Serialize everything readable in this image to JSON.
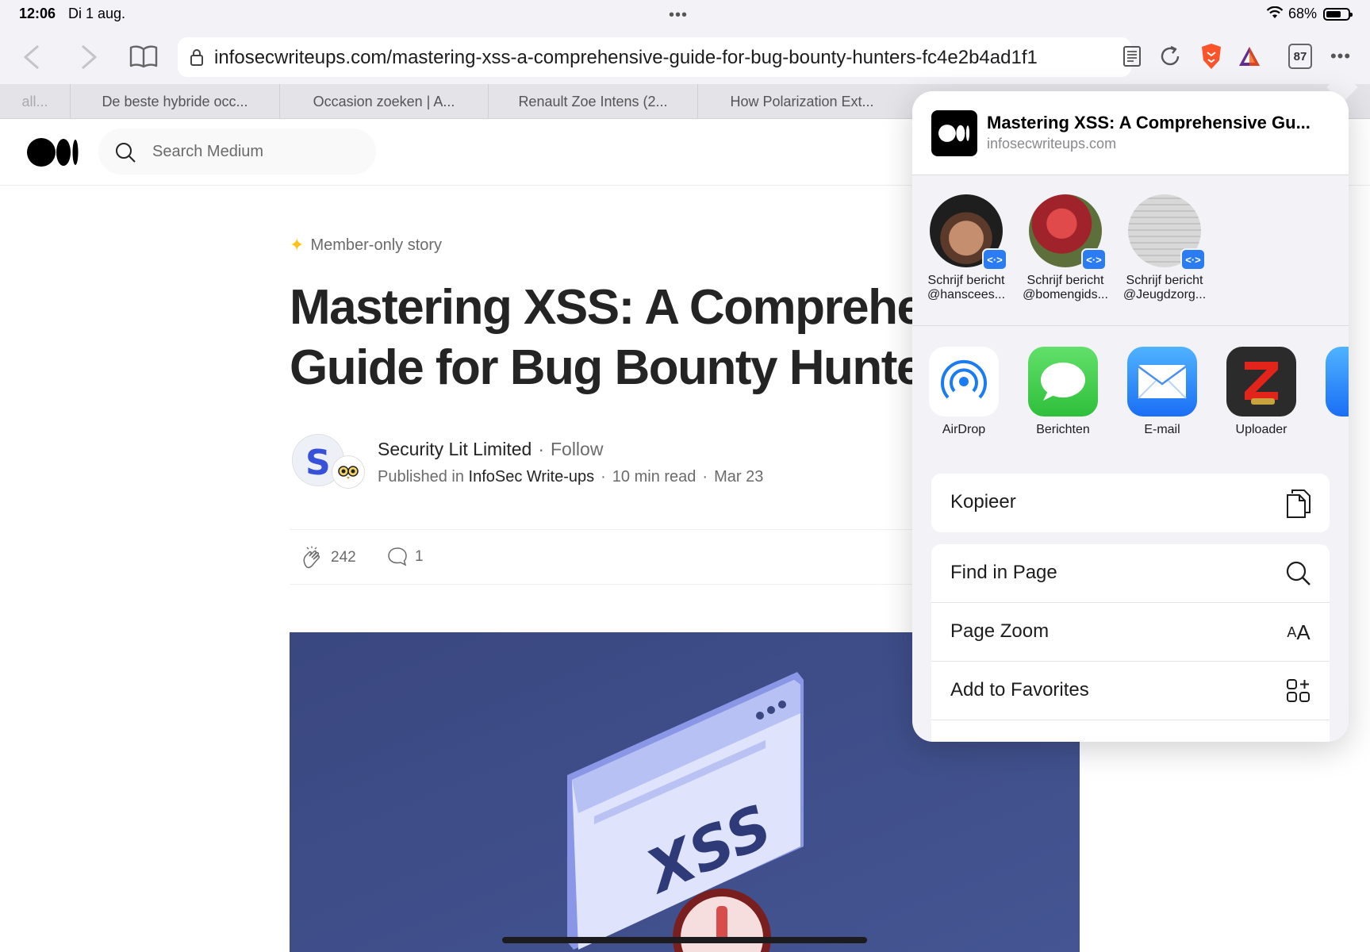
{
  "status_bar": {
    "time": "12:06",
    "date": "Di 1 aug.",
    "battery_percent": "68%",
    "battery_level": 0.68
  },
  "toolbar": {
    "url": "infosecwriteups.com/mastering-xss-a-comprehensive-guide-for-bug-bounty-hunters-fc4e2b4ad1f1",
    "tab_count": "87"
  },
  "tabs": [
    {
      "label": "all..."
    },
    {
      "label": "De beste hybride occ..."
    },
    {
      "label": "Occasion zoeken | A..."
    },
    {
      "label": "Renault Zoe Intens (2..."
    },
    {
      "label": "How Polarization Ext..."
    }
  ],
  "medium": {
    "search_placeholder": "Search Medium"
  },
  "article": {
    "member_label": "Member-only story",
    "title_line1": "Mastering XSS: A Comprehe",
    "title_line2": "Guide for Bug Bounty Hunter",
    "author": "Security Lit Limited",
    "follow_label": "Follow",
    "published_in_label": "Published in",
    "publication": "InfoSec Write-ups",
    "read_time": "10 min read",
    "date": "Mar 23",
    "claps": "242",
    "responses": "1",
    "hero_text": "XSS"
  },
  "share_sheet": {
    "title": "Mastering XSS: A Comprehensive Gu...",
    "domain": "infosecwriteups.com",
    "contacts": [
      {
        "line1": "Schrijf bericht",
        "line2": "@hanscees..."
      },
      {
        "line1": "Schrijf bericht",
        "line2": "@bomengids..."
      },
      {
        "line1": "Schrijf bericht",
        "line2": "@Jeugdzorg..."
      }
    ],
    "apps": [
      {
        "label": "AirDrop",
        "icon": "airdrop-icon"
      },
      {
        "label": "Berichten",
        "icon": "messages-icon"
      },
      {
        "label": "E-mail",
        "icon": "mail-icon"
      },
      {
        "label": "Uploader",
        "icon": "uploader-icon"
      },
      {
        "label": "",
        "icon": "partial-app-icon"
      }
    ],
    "actions": [
      {
        "label": "Kopieer",
        "icon": "copy-icon"
      },
      {
        "label": "Find in Page",
        "icon": "search-icon"
      },
      {
        "label": "Page Zoom",
        "icon": "text-size-icon",
        "glyph": "AA"
      },
      {
        "label": "Add to Favorites",
        "icon": "add-favorites-icon"
      }
    ]
  },
  "colors": {
    "accent_blue": "#2b7cf2",
    "brave_orange": "#fb542b",
    "medium_star": "#ffc017",
    "hero_bg": "#3c4a82"
  }
}
